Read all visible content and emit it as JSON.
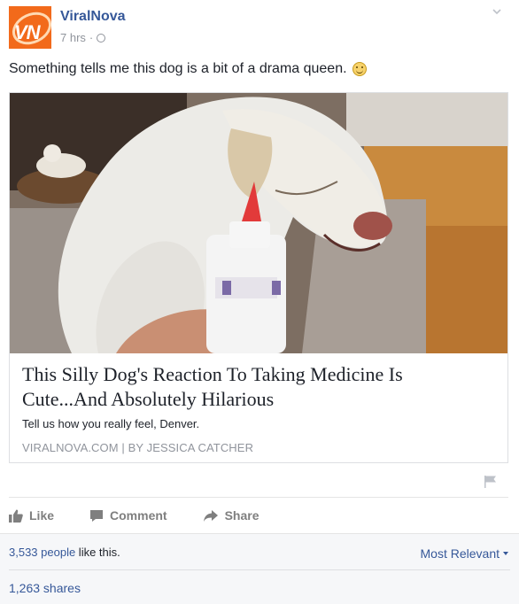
{
  "post": {
    "page_name": "ViralNova",
    "avatar_text": "VN",
    "timestamp": "7 hrs",
    "separator": "·",
    "privacy_icon": "globe-icon",
    "caption": "Something tells me this dog is a bit of a drama queen.",
    "caption_emoji": "smiley-icon"
  },
  "link": {
    "title": "This Silly Dog's Reaction To Taking Medicine Is Cute...And Absolutely Hilarious",
    "description": "Tell us how you really feel, Denver.",
    "source": "VIRALNOVA.COM | BY JESSICA CATCHER"
  },
  "actions": {
    "like": "Like",
    "comment": "Comment",
    "share": "Share"
  },
  "engagement": {
    "likes_count": "3,533 people",
    "likes_suffix": " like this.",
    "sort": "Most Relevant",
    "shares": "1,263 shares"
  },
  "colors": {
    "link_blue": "#365899",
    "text": "#1d2129",
    "muted": "#90949c",
    "avatar_orange": "#f26a1b"
  }
}
